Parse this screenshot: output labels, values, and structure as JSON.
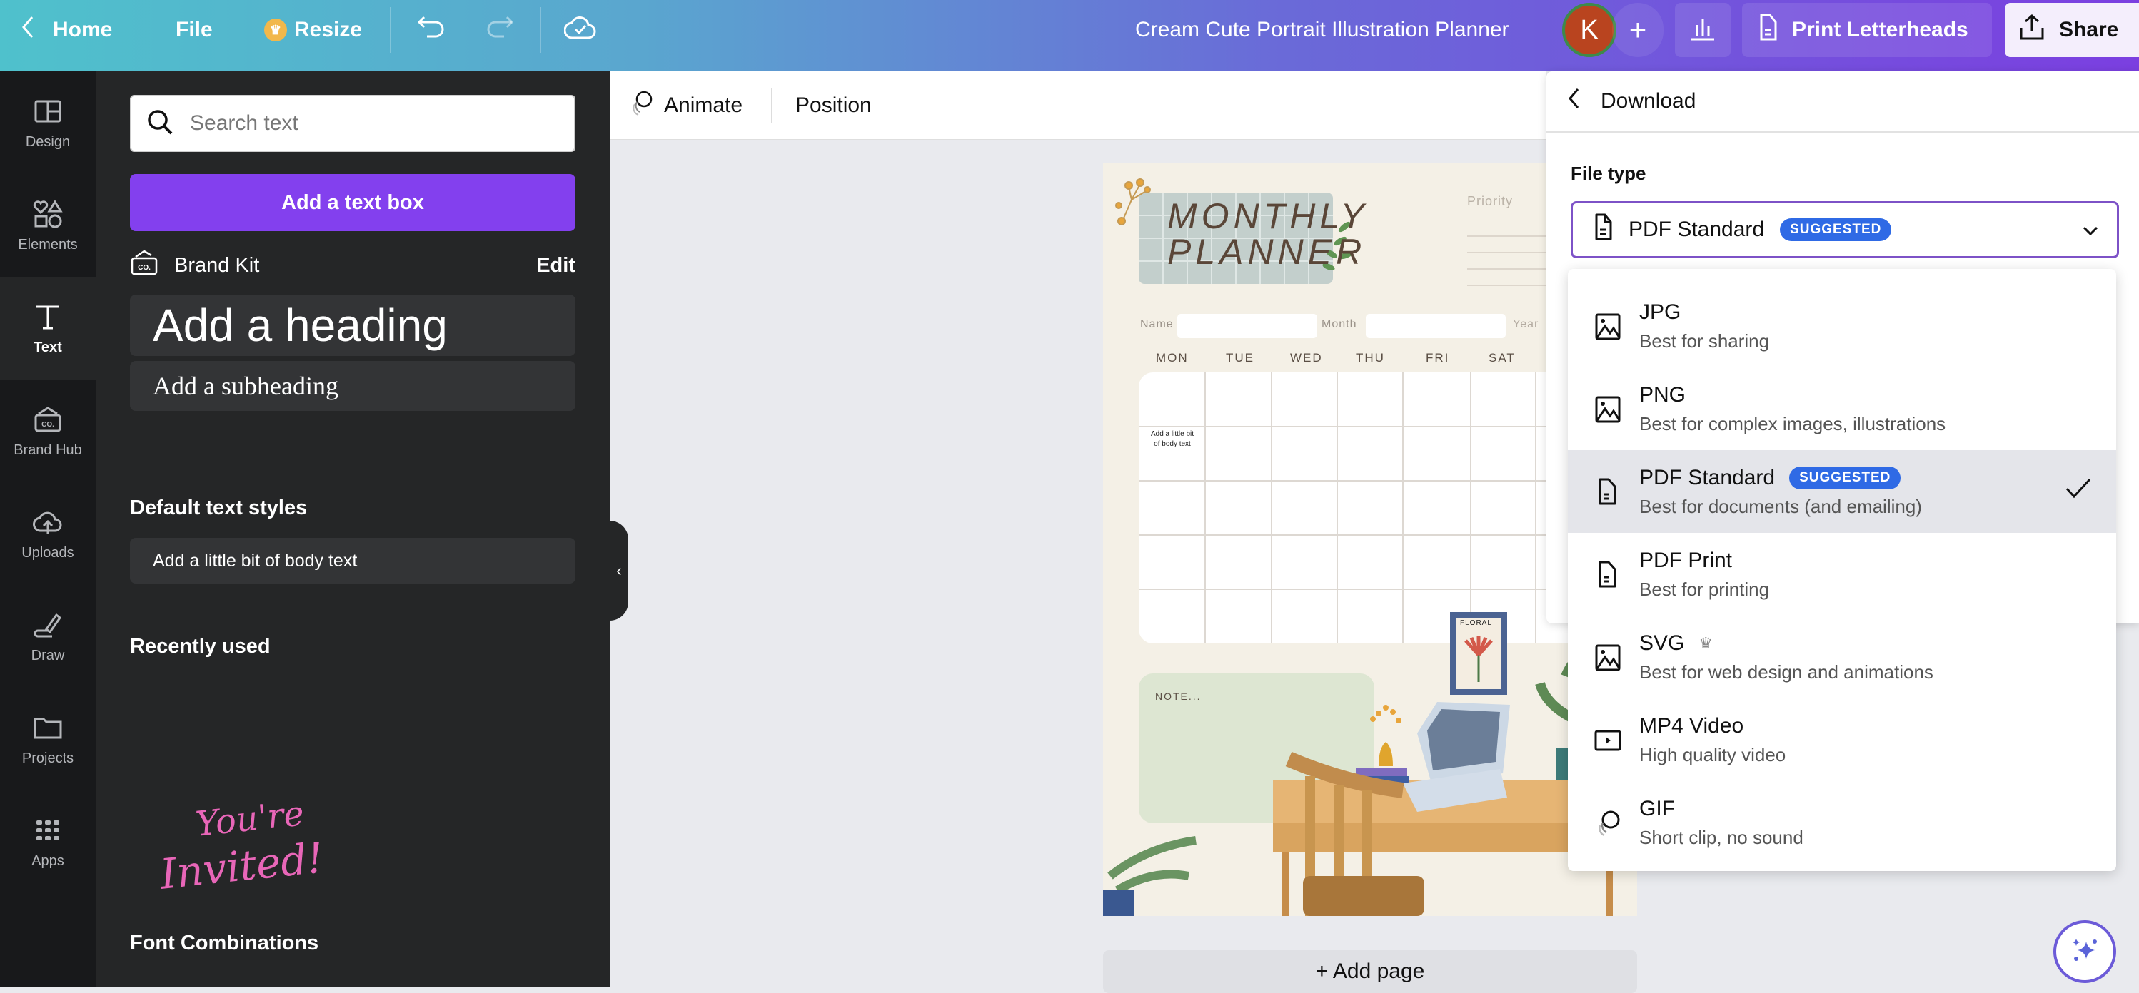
{
  "topbar": {
    "home_label": "Home",
    "file_label": "File",
    "resize_label": "Resize",
    "design_title": "Cream Cute Portrait Illustration Planner",
    "avatar_initial": "K",
    "print_label": "Print Letterheads",
    "share_label": "Share"
  },
  "rail": {
    "items": [
      {
        "label": "Design",
        "icon": "layout-icon"
      },
      {
        "label": "Elements",
        "icon": "shapes-icon"
      },
      {
        "label": "Text",
        "icon": "text-icon",
        "active": true
      },
      {
        "label": "Brand Hub",
        "icon": "brand-hub-icon"
      },
      {
        "label": "Uploads",
        "icon": "cloud-upload-icon"
      },
      {
        "label": "Draw",
        "icon": "pen-icon"
      },
      {
        "label": "Projects",
        "icon": "folder-icon"
      },
      {
        "label": "Apps",
        "icon": "apps-grid-icon"
      }
    ]
  },
  "text_panel": {
    "search_placeholder": "Search text",
    "add_textbox_label": "Add a text box",
    "brand_kit_label": "Brand Kit",
    "edit_label": "Edit",
    "heading_label": "Add a heading",
    "subheading_label": "Add a subheading",
    "default_styles_title": "Default text styles",
    "body_label": "Add a little bit of body text",
    "recently_used_title": "Recently used",
    "recent_item_text": [
      "You're",
      "Invited!"
    ],
    "font_combinations_title": "Font Combinations"
  },
  "context_toolbar": {
    "animate_label": "Animate",
    "position_label": "Position"
  },
  "canvas": {
    "planner_title": [
      "MONTHLY",
      "PLANNER"
    ],
    "priority_label": "Priority",
    "name_label": "Name",
    "month_label": "Month",
    "year_label": "Year",
    "days": [
      "MON",
      "TUE",
      "WED",
      "THU",
      "FRI",
      "SAT"
    ],
    "cell_text": [
      "Add a little bit",
      "of body text"
    ],
    "note_label": "NOTE...",
    "floral_label": "FLORAL",
    "add_page_label": "+ Add page"
  },
  "download": {
    "title": "Download",
    "file_type_label": "File type",
    "selected_value": "PDF Standard",
    "selected_badge": "SUGGESTED",
    "accent_color": "#7d52c7",
    "badge_color": "#2f6ae5",
    "options": [
      {
        "name": "JPG",
        "desc": "Best for sharing",
        "icon": "image-icon"
      },
      {
        "name": "PNG",
        "desc": "Best for complex images, illustrations",
        "icon": "image-icon"
      },
      {
        "name": "PDF Standard",
        "desc": "Best for documents (and emailing)",
        "icon": "document-icon",
        "badge": "SUGGESTED",
        "selected": true
      },
      {
        "name": "PDF Print",
        "desc": "Best for printing",
        "icon": "document-icon"
      },
      {
        "name": "SVG",
        "desc": "Best for web design and animations",
        "icon": "image-icon",
        "premium": true
      },
      {
        "name": "MP4 Video",
        "desc": "High quality video",
        "icon": "video-icon"
      },
      {
        "name": "GIF",
        "desc": "Short clip, no sound",
        "icon": "gif-icon"
      }
    ]
  }
}
